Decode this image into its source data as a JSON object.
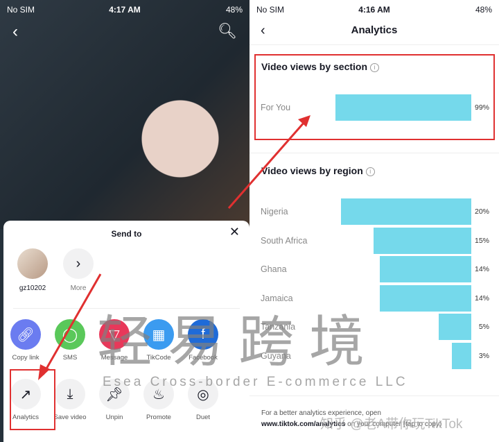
{
  "left": {
    "status": {
      "carrier": "No SIM",
      "time": "4:17 AM",
      "battery": "48%"
    },
    "sheet": {
      "title": "Send to",
      "contacts": [
        {
          "label": "gz10202"
        },
        {
          "label": "More",
          "icon": "chevron-right-icon"
        }
      ],
      "share": [
        {
          "label": "Copy link",
          "icon": "link-icon",
          "color": "#6b7cf0"
        },
        {
          "label": "SMS",
          "icon": "sms-icon",
          "color": "#5ac85a"
        },
        {
          "label": "Message",
          "icon": "message-icon",
          "color": "#e8385a"
        },
        {
          "label": "TikCode",
          "icon": "qr-code-icon",
          "color": "#3b9bf0"
        },
        {
          "label": "Facebook",
          "icon": "facebook-icon",
          "color": "#1f6bd8"
        }
      ],
      "actions": [
        {
          "label": "Analytics",
          "icon": "analytics-icon"
        },
        {
          "label": "Save video",
          "icon": "download-icon"
        },
        {
          "label": "Unpin",
          "icon": "pin-icon"
        },
        {
          "label": "Promote",
          "icon": "flame-icon"
        },
        {
          "label": "Duet",
          "icon": "duet-icon"
        }
      ]
    }
  },
  "right": {
    "status": {
      "carrier": "No SIM",
      "time": "4:16 AM",
      "battery": "48%"
    },
    "title": "Analytics",
    "section": {
      "title": "Video views by section",
      "items": [
        {
          "label": "For You",
          "value": 99,
          "display": "99%"
        }
      ]
    },
    "region": {
      "title": "Video views by region",
      "items": [
        {
          "label": "Nigeria",
          "value": 20,
          "display": "20%"
        },
        {
          "label": "South Africa",
          "value": 15,
          "display": "15%"
        },
        {
          "label": "Ghana",
          "value": 14,
          "display": "14%"
        },
        {
          "label": "Jamaica",
          "value": 14,
          "display": "14%"
        },
        {
          "label": "Tanzania",
          "value": 5,
          "display": "5%"
        },
        {
          "label": "Guyana",
          "value": 3,
          "display": "3%"
        }
      ]
    },
    "footer": {
      "line1": "For a better analytics experience, open",
      "link": "www.tiktok.com/analytics",
      "rest": " on your computer (tap to copy)"
    }
  },
  "bar_color": "#75d9eb",
  "highlight_color": "#e03030",
  "watermark": {
    "cn": "轻易跨境",
    "en": "Esea Cross-border E-commerce LLC",
    "zhihu": "知乎 @老A带你玩TikTok"
  }
}
